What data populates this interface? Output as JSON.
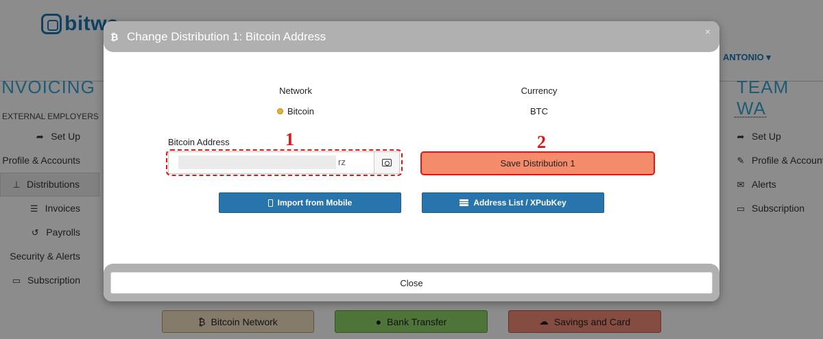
{
  "background": {
    "logo_text": "bitwa",
    "user_menu": "ANTONIO",
    "left_heading": "INVOICING",
    "right_heading": "TEAM WA",
    "left_menu": {
      "section": "EXTERNAL EMPLOYERS",
      "items": [
        {
          "label": "Set Up",
          "icon": "share-icon",
          "active": false
        },
        {
          "label": "Profile & Accounts",
          "icon": "none",
          "active": false
        },
        {
          "label": "Distributions",
          "icon": "sitemap-icon",
          "active": true
        },
        {
          "label": "Invoices",
          "icon": "list-icon",
          "active": false
        },
        {
          "label": "Payrolls",
          "icon": "history-icon",
          "active": false
        },
        {
          "label": "Security & Alerts",
          "icon": "none",
          "active": false
        },
        {
          "label": "Subscription",
          "icon": "credit-card-icon",
          "active": false
        }
      ]
    },
    "right_menu": {
      "section": "------------",
      "items": [
        {
          "label": "Set Up",
          "icon": "share-icon"
        },
        {
          "label": "Profile & Accounts",
          "icon": "edit-icon"
        },
        {
          "label": "Alerts",
          "icon": "envelope-icon"
        },
        {
          "label": "Subscription",
          "icon": "credit-card-icon"
        }
      ]
    },
    "bottom_buttons": {
      "bitcoin_network": "Bitcoin Network",
      "bank_transfer": "Bank Transfer",
      "savings_and_card": "Savings and Card"
    }
  },
  "modal": {
    "title": "Change Distribution 1: Bitcoin Address",
    "close_symbol": "×",
    "network_label": "Network",
    "network_value": "Bitcoin",
    "currency_label": "Currency",
    "currency_value": "BTC",
    "address_label": "Bitcoin Address",
    "address_visible_suffix": "rz",
    "save_button": "Save Distribution 1",
    "import_button": "Import from Mobile",
    "address_list_button": "Address List / XPubKey",
    "footer_close": "Close"
  },
  "annotations": {
    "marker_1": "1",
    "marker_2": "2",
    "color": "#e01515"
  },
  "colors": {
    "primary_blue": "#2874ad",
    "save_fill": "#f48b6b",
    "modal_header": "#b0b0b0"
  }
}
